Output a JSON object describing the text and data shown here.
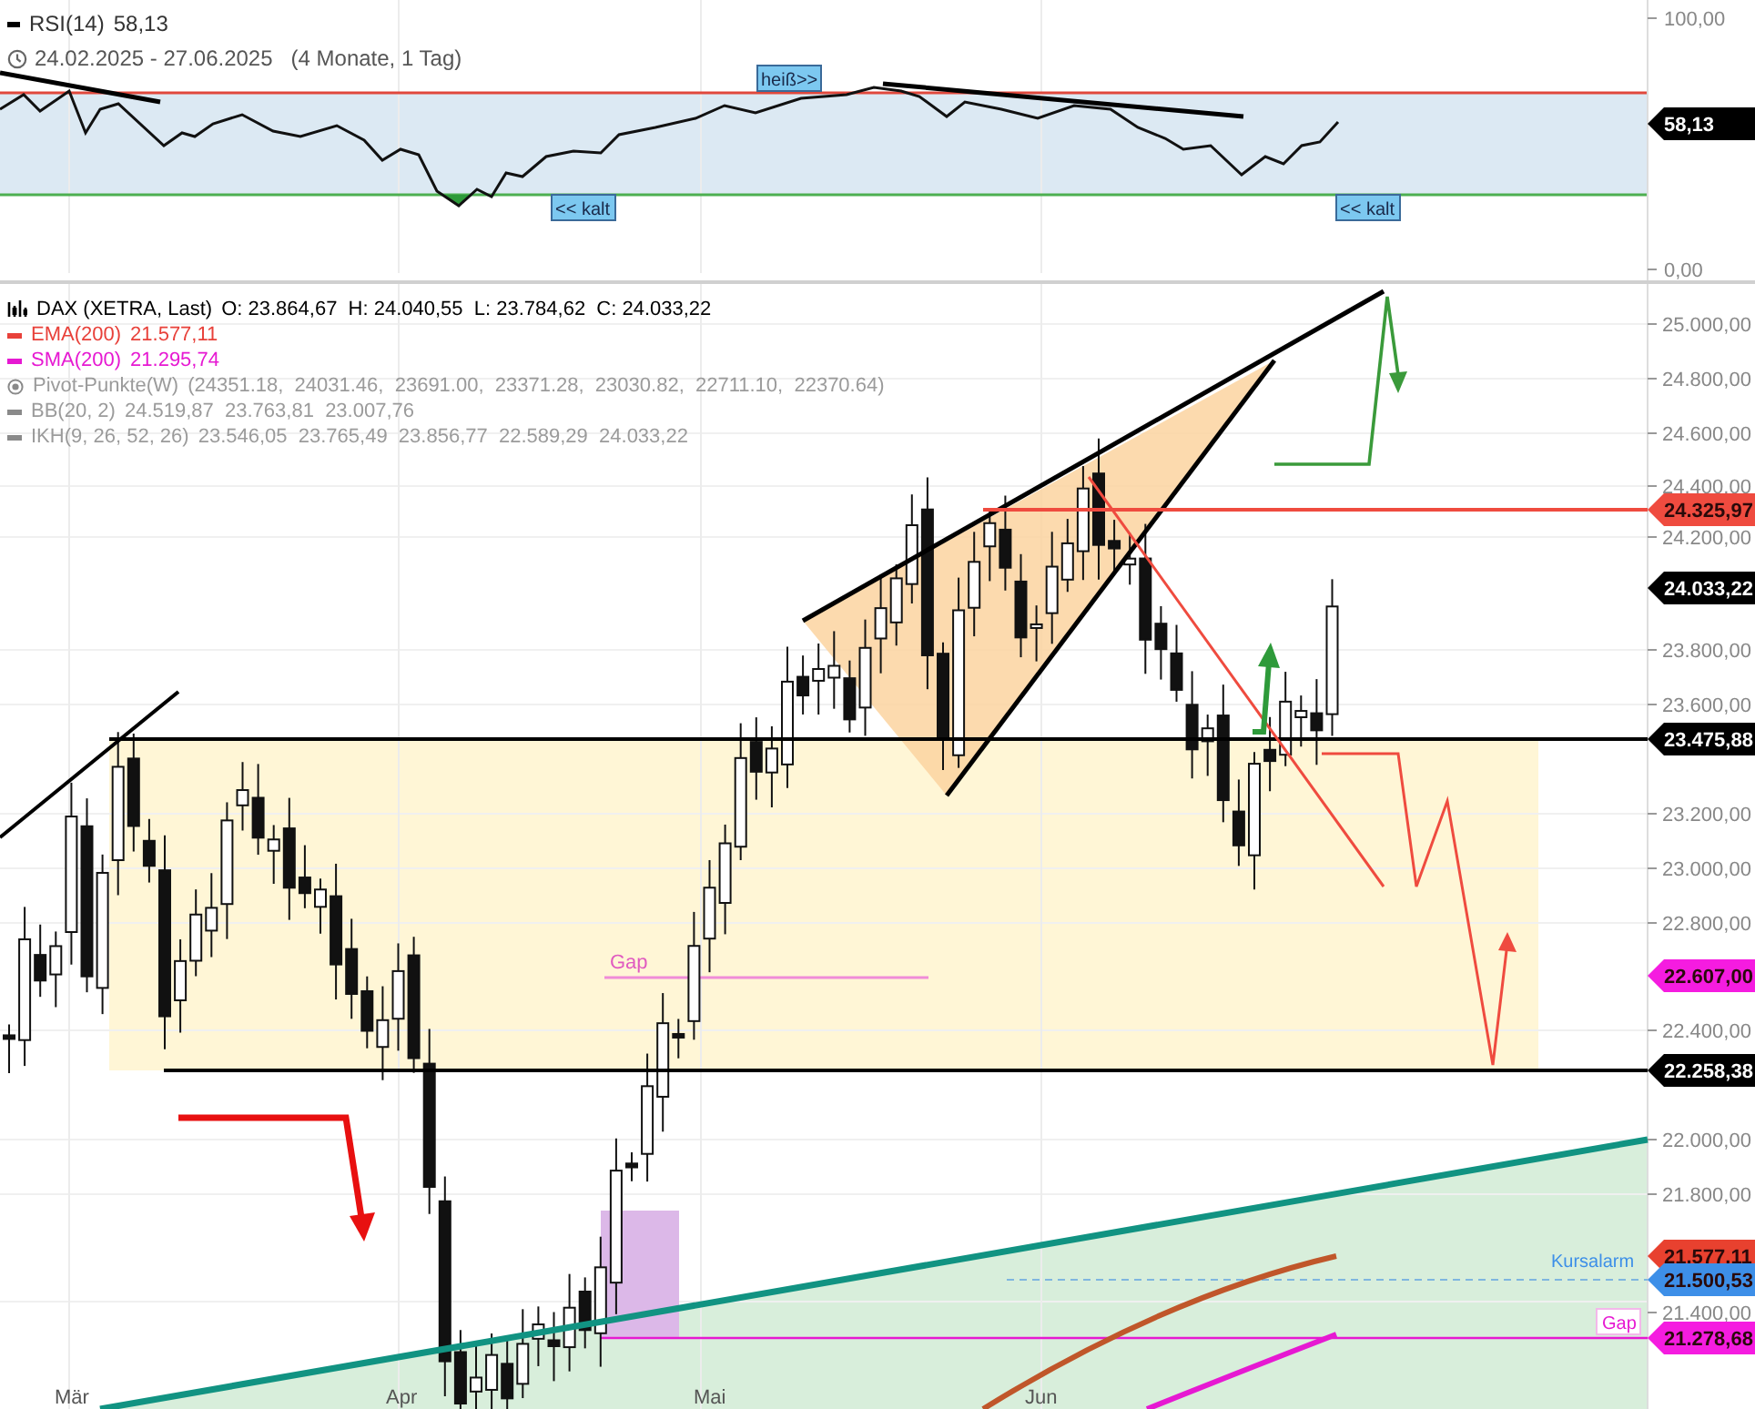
{
  "rsi_panel": {
    "indicator_label": "RSI(14)",
    "indicator_value": "58,13",
    "date_range": "24.02.2025 - 27.06.2025",
    "duration": "(4 Monate, 1 Tag)",
    "y_axis_labels": [
      "100,00",
      "0,00"
    ],
    "zone_labels": [
      {
        "text": "heiß>>"
      },
      {
        "text": "<< kalt"
      },
      {
        "text": "<< kalt"
      }
    ],
    "value_tag": {
      "text": "58,13",
      "color": "#000000"
    }
  },
  "main_chart": {
    "legend": [
      {
        "kind": "instrument",
        "label": "DAX (XETRA, Last)",
        "values": "O: 23.864,67  H: 24.040,55  L: 23.784,62  C: 24.033,22",
        "color": "#000000",
        "dimmed": false
      },
      {
        "kind": "line",
        "label": "EMA(200)",
        "values": "21.577,11",
        "color": "#e8413a",
        "dimmed": false
      },
      {
        "kind": "line",
        "label": "SMA(200)",
        "values": "21.295,74",
        "color": "#e619d2",
        "dimmed": false
      },
      {
        "kind": "pivot",
        "label": "Pivot-Punkte(W)",
        "values": "(24351.18,  24031.46,  23691.00,  23371.28,  23030.82,  22711.10,  22370.64)",
        "color": "#8a8a8a",
        "dimmed": true
      },
      {
        "kind": "line",
        "label": "BB(20, 2)",
        "values": "24.519,87  23.763,81  23.007,76",
        "color": "#8a8a8a",
        "dimmed": true
      },
      {
        "kind": "line",
        "label": "IKH(9, 26, 52, 26)",
        "values": "23.546,05  23.765,49  23.856,77  22.589,29  24.033,22",
        "color": "#8a8a8a",
        "dimmed": true
      }
    ],
    "y_axis_labels": [
      "25.000,00",
      "24.800,00",
      "24.600,00",
      "24.400,00",
      "24.200,00",
      "23.800,00",
      "23.600,00",
      "23.200,00",
      "23.000,00",
      "22.800,00",
      "22.400,00",
      "22.000,00",
      "21.800,00",
      "21.400,00"
    ],
    "price_tags": [
      {
        "text": "24.325,97",
        "color": "#ef4b3f"
      },
      {
        "text": "24.033,22",
        "color": "#000000"
      },
      {
        "text": "23.475,88",
        "color": "#000000"
      },
      {
        "text": "22.607,00",
        "color": "#f51ce0"
      },
      {
        "text": "22.258,38",
        "color": "#000000"
      },
      {
        "text": "21.577,11",
        "color": "#e8412f"
      },
      {
        "text": "21.500,53",
        "color": "#3d8fe8"
      },
      {
        "text": "21.278,68",
        "color": "#f51ce0"
      }
    ],
    "gap_label": "Gap",
    "alarm_label": "Kursalarm",
    "lower_gap_label": "Gap",
    "x_axis_labels": [
      "Mär",
      "Apr",
      "Mai",
      "Jun"
    ]
  }
}
